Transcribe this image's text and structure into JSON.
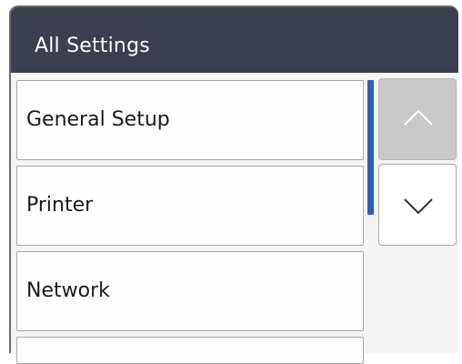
{
  "header": {
    "title": "All Settings"
  },
  "menu": {
    "items": [
      {
        "label": "General Setup"
      },
      {
        "label": "Printer"
      },
      {
        "label": "Network"
      },
      {
        "label": ""
      }
    ]
  },
  "scroll": {
    "up_icon": "chevron-up-icon",
    "down_icon": "chevron-down-icon",
    "up_enabled": false,
    "down_enabled": true
  },
  "colors": {
    "header_bg": "#3b3f4f",
    "scroll_indicator": "#2f5fb5",
    "disabled_button": "#c9c9c9"
  }
}
